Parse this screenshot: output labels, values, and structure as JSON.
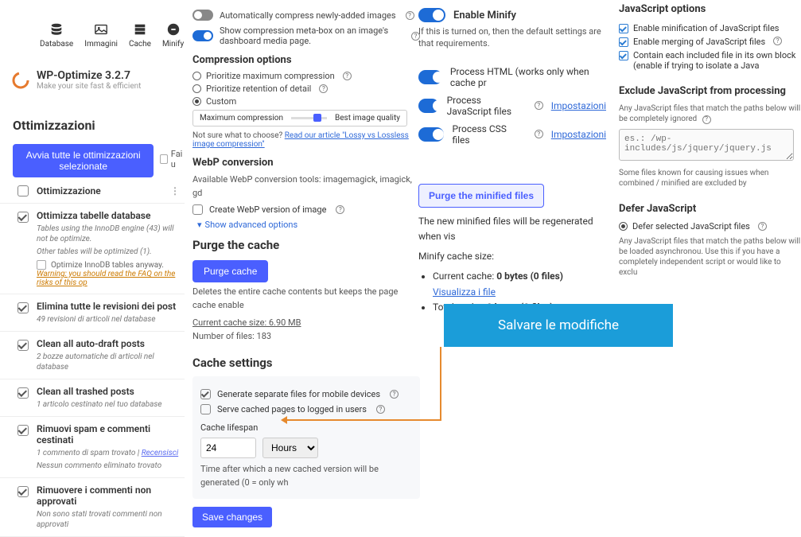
{
  "nav": {
    "items": [
      {
        "key": "database",
        "label": "Database"
      },
      {
        "key": "images",
        "label": "Immagini"
      },
      {
        "key": "cache",
        "label": "Cache"
      },
      {
        "key": "minify",
        "label": "Minify"
      }
    ]
  },
  "brand": {
    "title": "WP-Optimize 3.2.7",
    "subtitle": "Make your site fast & efficient"
  },
  "opt": {
    "heading": "Ottimizzazioni",
    "run_button": "Avvia tutte le ottimizzazioni selezionate",
    "fai_u": "Fai u",
    "column": "Ottimizzazione",
    "items": [
      {
        "title": "Ottimizza tabelle database",
        "desc1": "Tables using the InnoDB engine (43) will not be optimize.",
        "desc2_label": "Optimize InnoDB tables anyway.",
        "desc3": "Other tables will be optimized (1).",
        "warn": "Warning: you should read the FAQ on the risks of this op"
      },
      {
        "title": "Elimina tutte le revisioni dei post",
        "sub": "49 revisioni di articoli nel database"
      },
      {
        "title": "Clean all auto-draft posts",
        "sub": "2 bozze automatiche di articoli nel database"
      },
      {
        "title": "Clean all trashed posts",
        "sub": "1 articolo cestinato nel tuo database"
      },
      {
        "title": "Rimuovi spam e commenti cestinati",
        "sub": "1 commento di spam trovato | ",
        "link": "Recensisci",
        "sub2": "Nessun commento eliminato trovato"
      },
      {
        "title": "Rimuovere i commenti non approvati",
        "sub": "Non sono stati trovati commenti non approvati"
      }
    ]
  },
  "img": {
    "auto_compress": "Automatically compress newly-added images",
    "meta_box": "Show compression meta-box on an image's dashboard media page.",
    "opts_head": "Compression options",
    "r1": "Prioritize maximum compression",
    "r2": "Prioritize retention of detail",
    "r3": "Custom",
    "slider_left": "Maximum compression",
    "slider_right": "Best image quality",
    "hint_prefix": "Not sure what to choose? ",
    "hint_link": "Read our article \"Lossy vs Lossless image compression\"",
    "webp_head": "WebP conversion",
    "webp_tools": "Available WebP conversion tools: imagemagick, imagick, gd",
    "webp_create": "Create WebP version of image",
    "show_adv": "Show advanced options"
  },
  "purge": {
    "head": "Purge the cache",
    "btn": "Purge cache",
    "desc": "Deletes the entire cache contents but keeps the page cache enable",
    "size": "Current cache size: 6.90 MB",
    "files": "Number of files: 183"
  },
  "cache": {
    "head": "Cache settings",
    "gen": "Generate separate files for mobile devices",
    "serve": "Serve cached pages to logged in users",
    "lifespan_label": "Cache lifespan",
    "lifespan_value": "24",
    "lifespan_unit": "Hours",
    "note": "Time after which a new cached version will be generated (0 = only wh",
    "save": "Save changes"
  },
  "minify": {
    "enable": "Enable Minify",
    "desc": "If this is turned on, then the default settings are that requirements.",
    "f_html": "Process HTML (works only when cache pr",
    "f_js": "Process JavaScript files",
    "f_css": "Process CSS files",
    "settings_link": "Impostazioni",
    "purge_btn": "Purge the minified files",
    "regen": "The new minified files will be regenerated when vis",
    "size_label": "Minify cache size:",
    "cur": "Current cache: ",
    "cur_val": "0 bytes (0 files)",
    "cur_link": "Visualizza i file",
    "tot": "Total cache: ",
    "tot_val": "0 bytes (0 files)"
  },
  "js": {
    "head": "JavaScript options",
    "o1": "Enable minification of JavaScript files",
    "o2": "Enable merging of JavaScript files",
    "o3": "Contain each included file in its own block (enable if trying to isolate a Java",
    "excl_head": "Exclude JavaScript from processing",
    "excl_note": "Any JavaScript files that match the paths below will be completely ignored",
    "excl_placeholder": "es.: /wp-includes/js/jquery/jquery.js",
    "note2": "Some files known for causing issues when combined / minified are excluded by",
    "defer_head": "Defer JavaScript",
    "defer_label": "Defer selected JavaScript files",
    "defer_note": "Any JavaScript files that match the paths below will be loaded asynchronou. Use this if you have a completely independent script or would like to exclu"
  },
  "callout": "Salvare le modifiche"
}
